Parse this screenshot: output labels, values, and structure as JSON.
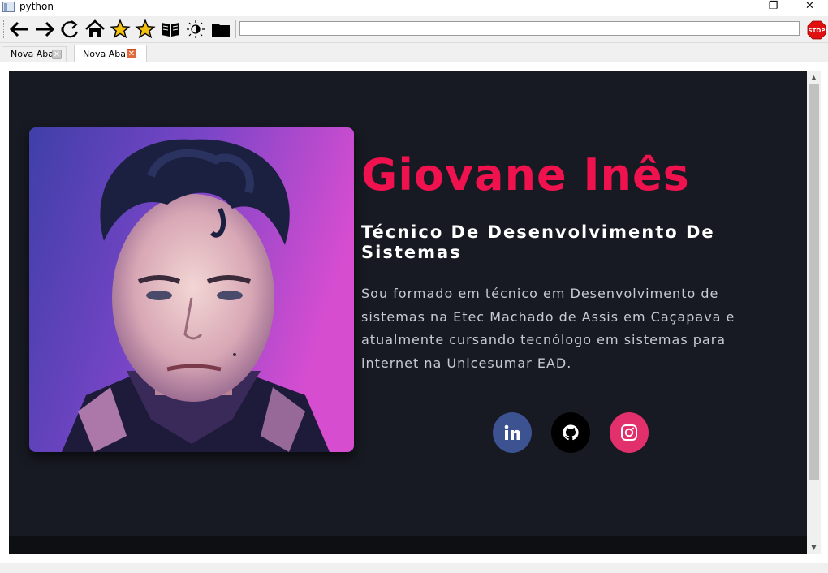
{
  "window": {
    "title": "python",
    "minimize": "—",
    "maximize": "❐",
    "close": "✕"
  },
  "toolbar": {
    "icons": [
      "back-arrow-icon",
      "forward-arrow-icon",
      "reload-icon",
      "home-icon",
      "star-icon",
      "star-icon",
      "book-icon",
      "brightness-icon",
      "folder-icon"
    ],
    "url_value": "",
    "stop_label": "STOP"
  },
  "tabs": [
    {
      "label": "Nova Aba",
      "active": false
    },
    {
      "label": "Nova Aba",
      "active": true
    }
  ],
  "profile": {
    "name": "Giovane Inês",
    "role": "Técnico De Desenvolvimento De Sistemas",
    "bio": "Sou formado em técnico em Desenvolvimento de sistemas na Etec Machado de Assis em Caçapava e atualmente cursando tecnólogo em sistemas para internet na Unicesumar EAD."
  },
  "social": [
    {
      "name": "linkedin-icon",
      "color": "#3c5291"
    },
    {
      "name": "github-icon",
      "color": "#000000"
    },
    {
      "name": "instagram-icon",
      "color": "#e1306c"
    }
  ],
  "colors": {
    "accent": "#f0124e",
    "page_bg": "#171a22"
  }
}
